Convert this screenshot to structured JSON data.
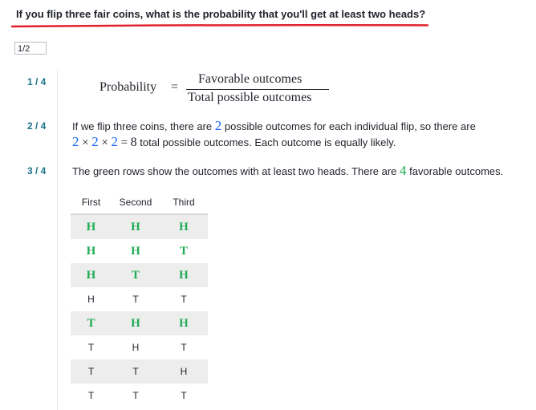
{
  "question": "If you flip three fair coins, what is the probability that you'll get at least two heads?",
  "answer_value": "1/2",
  "colors": {
    "step_number": "#1c758a",
    "blue_math": "#1865f2",
    "green_math": "#1fab54",
    "underline": "#e0202a"
  },
  "steps": {
    "s1": {
      "num": "1 / 4",
      "lhs": "Probability",
      "eq": "=",
      "numerator": "Favorable outcomes",
      "denominator": "Total possible outcomes"
    },
    "s2": {
      "num": "2 / 4",
      "t1": "If we flip three coins, there are",
      "n1": "2",
      "t2": "possible outcomes for each individual flip, so there are",
      "a": "2",
      "op1": "×",
      "b": "2",
      "op2": "×",
      "c": "2",
      "eq": "=",
      "total": "8",
      "t3": "total possible outcomes. Each outcome is equally likely."
    },
    "s3": {
      "num": "3 / 4",
      "t1": "The green rows show the outcomes with at least two heads. There are",
      "n1": "4",
      "t2": "favorable outcomes."
    }
  },
  "table": {
    "headers": [
      "First",
      "Second",
      "Third"
    ],
    "rows": [
      {
        "cells": [
          "H",
          "H",
          "H"
        ],
        "favorable": true
      },
      {
        "cells": [
          "H",
          "H",
          "T"
        ],
        "favorable": true
      },
      {
        "cells": [
          "H",
          "T",
          "H"
        ],
        "favorable": true
      },
      {
        "cells": [
          "H",
          "T",
          "T"
        ],
        "favorable": false
      },
      {
        "cells": [
          "T",
          "H",
          "H"
        ],
        "favorable": true
      },
      {
        "cells": [
          "T",
          "H",
          "T"
        ],
        "favorable": false
      },
      {
        "cells": [
          "T",
          "T",
          "H"
        ],
        "favorable": false
      },
      {
        "cells": [
          "T",
          "T",
          "T"
        ],
        "favorable": false
      }
    ]
  }
}
